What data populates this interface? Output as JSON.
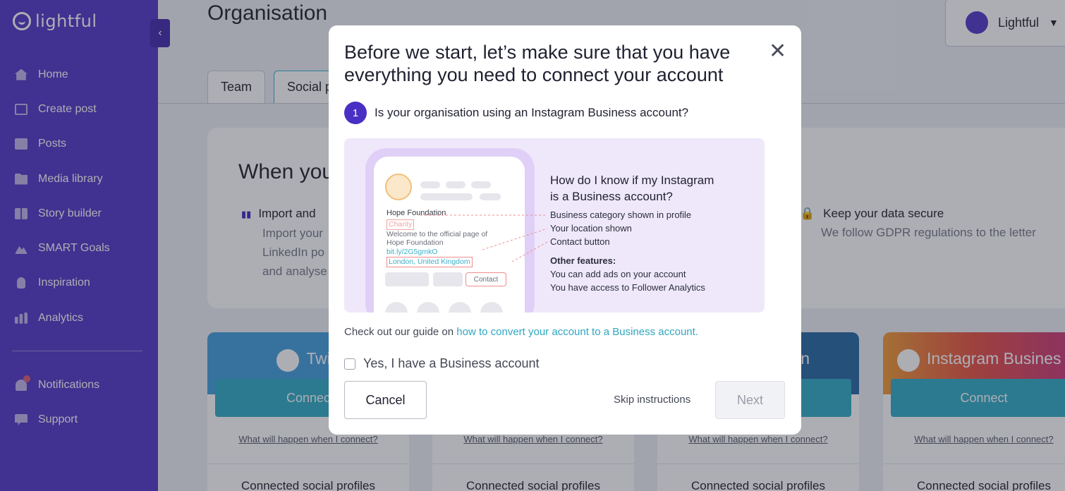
{
  "app": {
    "logo_text": "lightful",
    "collapse_icon": "chevron-left-icon"
  },
  "sidebar": {
    "items": [
      {
        "label": "Home",
        "icon": "home-icon"
      },
      {
        "label": "Create post",
        "icon": "edit-icon"
      },
      {
        "label": "Posts",
        "icon": "posts-icon"
      },
      {
        "label": "Media library",
        "icon": "folder-icon"
      },
      {
        "label": "Story builder",
        "icon": "story-icon"
      },
      {
        "label": "SMART Goals",
        "icon": "mountain-icon"
      },
      {
        "label": "Inspiration",
        "icon": "lightbulb-icon"
      },
      {
        "label": "Analytics",
        "icon": "bar-chart-icon"
      }
    ],
    "bottom_items": [
      {
        "label": "Notifications",
        "icon": "bell-icon"
      },
      {
        "label": "Support",
        "icon": "chat-icon"
      }
    ]
  },
  "header": {
    "title": "Organisation",
    "user_name": "Lightful"
  },
  "tabs": [
    {
      "label": "Team"
    },
    {
      "label": "Social p"
    }
  ],
  "info": {
    "heading": "When you",
    "left_title": "Import and",
    "left_lines": [
      "Import your",
      "LinkedIn po",
      "and analyse"
    ],
    "right_title": "Keep your data secure",
    "right_sub": "We follow GDPR regulations to the letter"
  },
  "social_cards": [
    {
      "name": "Twitt",
      "connect": "Connec",
      "link": "What will happen when I connect?",
      "footer": "Connected social profiles",
      "color": "#4aa3df"
    },
    {
      "name": "",
      "connect": "",
      "link": "What will happen when I connect?",
      "footer": "Connected social profiles",
      "color": "#3a8fd0"
    },
    {
      "name": "n",
      "connect": "",
      "link": "What will happen when I connect?",
      "footer": "Connected social profiles",
      "color": "#2e6fa6"
    },
    {
      "name": "Instagram Busines",
      "connect": "Connect",
      "link": "What will happen when I connect?",
      "footer": "Connected social profiles",
      "color": "#e8584a"
    }
  ],
  "modal": {
    "title": "Before we start, let’s make sure that you have everything you need to connect your account",
    "step_number": "1",
    "step_question": "Is your organisation using an Instagram Business account?",
    "illustration": {
      "profile_name": "Hope Foundation",
      "profile_category": "Charity",
      "profile_desc_1": "Welcome to the official page of",
      "profile_desc_2": "Hope Foundation",
      "profile_link": "bit.ly/2G5gmkO",
      "profile_location": "London, United Kingdom",
      "profile_contact": "Contact",
      "heading_1": "How do I know if my Instagram",
      "heading_2": "is a Business account?",
      "line_1": "Business category shown in profile",
      "line_2": "Your location shown",
      "line_3": "Contact button",
      "other_title": "Other features:",
      "other_1": "You can add ads on your account",
      "other_2": "You have access to Follower Analytics"
    },
    "guide_prefix": "Check out our guide on",
    "guide_link": "how to convert your account to a Business account.",
    "checkbox_label": "Yes, I have a Business account",
    "cancel": "Cancel",
    "skip": "Skip instructions",
    "next": "Next"
  }
}
